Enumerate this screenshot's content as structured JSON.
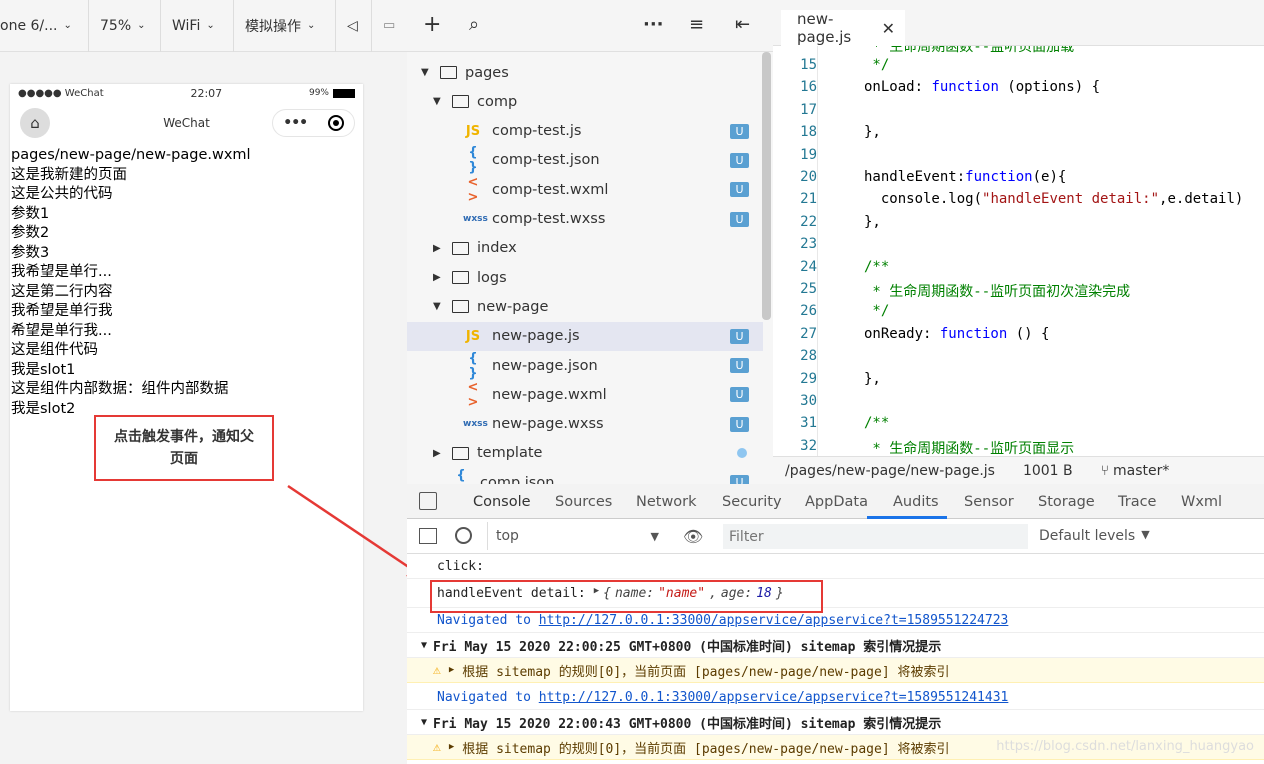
{
  "sim_toolbar": {
    "device": "one 6/...",
    "zoom": "75%",
    "network": "WiFi",
    "operation": "模拟操作"
  },
  "phone": {
    "status": {
      "carrier": "●●●●● WeChat",
      "time": "22:07",
      "battery": "99%"
    },
    "nav_title": "WeChat",
    "lines": [
      "pages/new-page/new-page.wxml",
      "这是我新建的页面",
      "这是公共的代码",
      "参数1",
      "参数2",
      "参数3",
      "我希望是单行...",
      "这是第二行内容",
      "我希望是单行我",
      "希望是单行我...",
      "这是组件代码",
      "我是slot1",
      "这是组件内部数据：组件内部数据",
      "我是slot2"
    ],
    "trigger_button": "点击触发事件，通知父页面"
  },
  "tree": {
    "items": [
      {
        "label": "pages",
        "type": "folder",
        "open": true
      },
      {
        "label": "comp",
        "type": "folder",
        "open": true
      },
      {
        "label": "comp-test.js",
        "type": "js",
        "badge": "U"
      },
      {
        "label": "comp-test.json",
        "type": "json",
        "badge": "U"
      },
      {
        "label": "comp-test.wxml",
        "type": "wxml",
        "badge": "U"
      },
      {
        "label": "comp-test.wxss",
        "type": "wxss",
        "badge": "U"
      },
      {
        "label": "index",
        "type": "folder",
        "open": false
      },
      {
        "label": "logs",
        "type": "folder",
        "open": false
      },
      {
        "label": "new-page",
        "type": "folder",
        "open": true
      },
      {
        "label": "new-page.js",
        "type": "js",
        "badge": "U"
      },
      {
        "label": "new-page.json",
        "type": "json",
        "badge": "U"
      },
      {
        "label": "new-page.wxml",
        "type": "wxml",
        "badge": "U"
      },
      {
        "label": "new-page.wxss",
        "type": "wxss",
        "badge": "U"
      },
      {
        "label": "template",
        "type": "folder",
        "open": false
      },
      {
        "label": "comp.json",
        "type": "json",
        "badge": "U"
      }
    ],
    "icons": {
      "js": "JS",
      "json": "{ }",
      "wxml": "< >",
      "wxss": "wxss"
    }
  },
  "editor": {
    "tab": "new-page.js",
    "lines": [
      {
        "n": "15",
        "text": " */"
      },
      {
        "n": "16",
        "text": "onLoad: function (options) {"
      },
      {
        "n": "17",
        "text": ""
      },
      {
        "n": "18",
        "text": "},"
      },
      {
        "n": "19",
        "text": ""
      },
      {
        "n": "20",
        "text": "handleEvent:function(e){"
      },
      {
        "n": "21",
        "text": "  console.log(\"handleEvent detail:\",e.detail)"
      },
      {
        "n": "22",
        "text": "},"
      },
      {
        "n": "23",
        "text": ""
      },
      {
        "n": "24",
        "text": "/**"
      },
      {
        "n": "25",
        "text": " * 生命周期函数--监听页面初次渲染完成"
      },
      {
        "n": "26",
        "text": " */"
      },
      {
        "n": "27",
        "text": "onReady: function () {"
      },
      {
        "n": "28",
        "text": ""
      },
      {
        "n": "29",
        "text": "},"
      },
      {
        "n": "30",
        "text": ""
      },
      {
        "n": "31",
        "text": "/**"
      },
      {
        "n": "32",
        "text": " * 生命周期函数--监听页面显示"
      }
    ],
    "top_partial": " * 生命周期函数--监听页面加载",
    "status": {
      "path": "/pages/new-page/new-page.js",
      "size": "1001 B",
      "branch": "master*"
    }
  },
  "devtools": {
    "tabs": [
      "Console",
      "Sources",
      "Network",
      "Security",
      "AppData",
      "Audits",
      "Sensor",
      "Storage",
      "Trace",
      "Wxml"
    ],
    "active_tab": "Console",
    "context": "top",
    "filter_placeholder": "Filter",
    "levels": "Default levels"
  },
  "console": {
    "click": "click:",
    "event_label": "handleEvent detail:",
    "event_obj": {
      "name_key": "name:",
      "name_val": "\"name\"",
      "age_key": "age:",
      "age_val": "18"
    },
    "nav1_prefix": "Navigated to",
    "nav1_url": "http://127.0.0.1:33000/appservice/appservice?t=1589551224723",
    "group1": "Fri May 15 2020 22:00:25 GMT+0800 (中国标准时间) sitemap 索引情况提示",
    "warn1": "根据 sitemap 的规则[0]，当前页面 [pages/new-page/new-page] 将被索引",
    "nav2_prefix": "Navigated to",
    "nav2_url": "http://127.0.0.1:33000/appservice/appservice?t=1589551241431",
    "group2": "Fri May 15 2020 22:00:43 GMT+0800 (中国标准时间) sitemap 索引情况提示",
    "warn2": "根据 sitemap 的规则[0]，当前页面 [pages/new-page/new-page] 将被索引"
  },
  "watermark": "https://blog.csdn.net/lanxing_huangyao"
}
